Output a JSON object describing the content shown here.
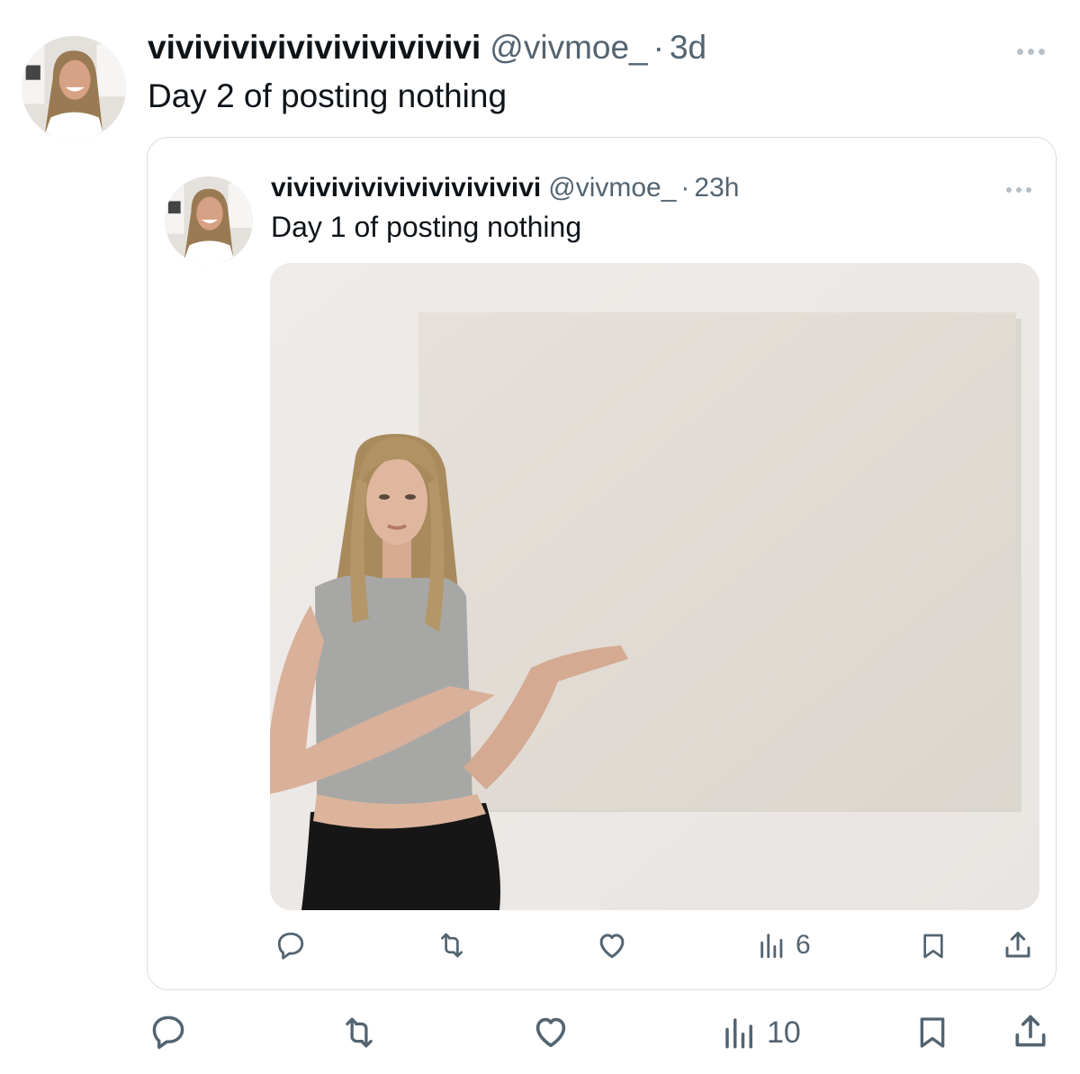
{
  "outer_tweet": {
    "display_name": "vivivivivivivivivivivivi",
    "handle": "@vivmoe_",
    "separator": "·",
    "time": "3d",
    "text": "Day 2 of posting nothing",
    "actions": {
      "reply_icon": "reply-icon",
      "retweet_icon": "retweet-icon",
      "like_icon": "like-icon",
      "views_icon": "views-icon",
      "views_count": "10",
      "bookmark_icon": "bookmark-icon",
      "share_icon": "share-icon"
    }
  },
  "quoted_tweet": {
    "display_name": "vivivivivivivivivivivivi",
    "handle": "@vivmoe_",
    "separator": "·",
    "time": "23h",
    "text": "Day 1 of posting nothing",
    "media": "photo of a person pointing at a blank white canvas on a wall",
    "actions": {
      "reply_icon": "reply-icon",
      "retweet_icon": "retweet-icon",
      "like_icon": "like-icon",
      "views_icon": "views-icon",
      "views_count": "6",
      "bookmark_icon": "bookmark-icon",
      "share_icon": "share-icon"
    }
  },
  "colors": {
    "text_primary": "#0f1419",
    "text_secondary": "#536471",
    "border": "#d7dde1",
    "dots": "#b8c0c7"
  }
}
